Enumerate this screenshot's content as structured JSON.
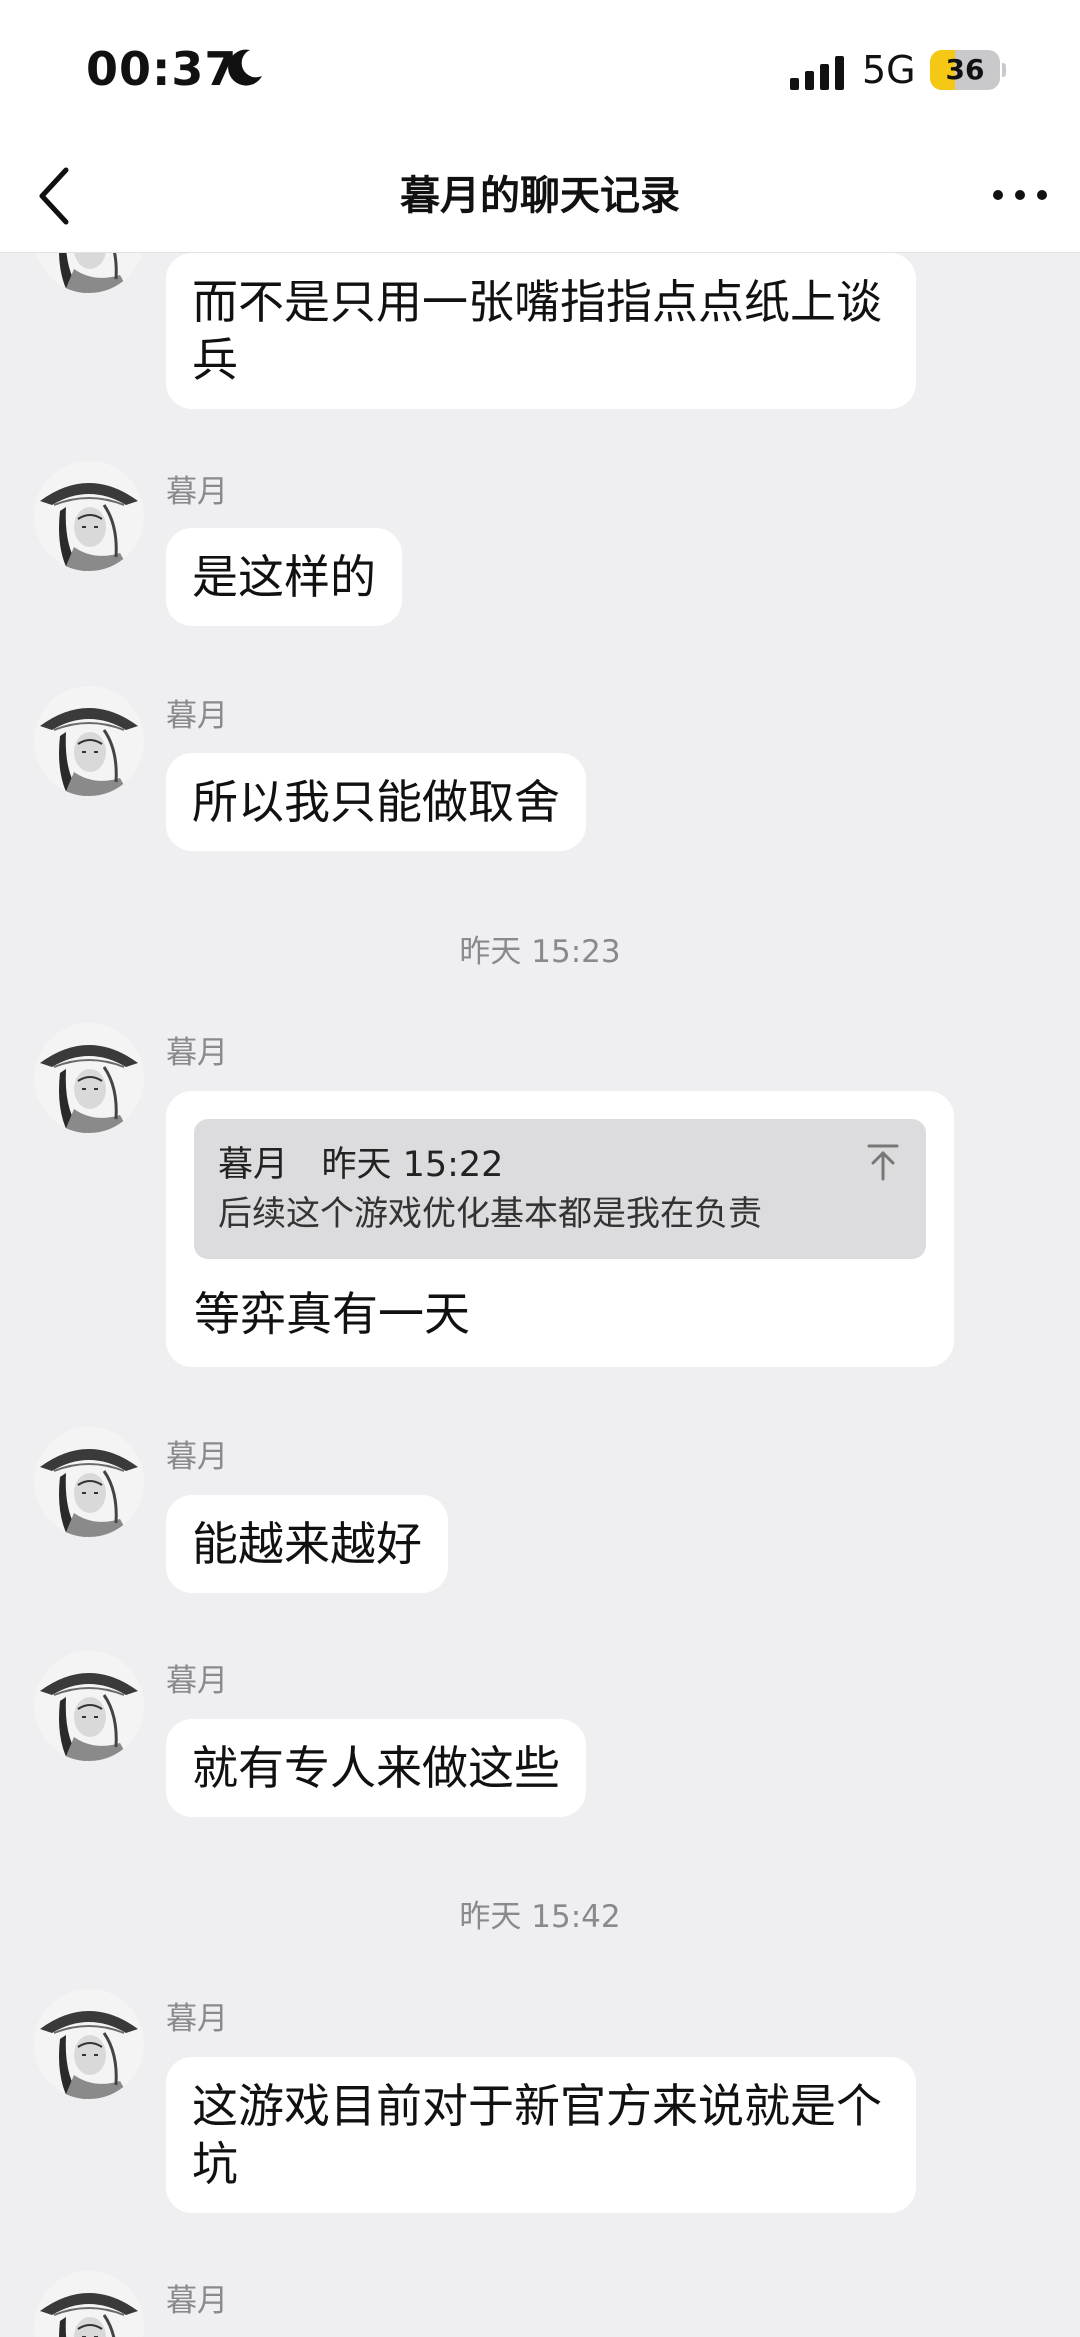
{
  "status_bar": {
    "time": "00:37",
    "network": "5G",
    "battery": "36",
    "battery_level": 0.36
  },
  "header": {
    "title": "暮月的聊天记录"
  },
  "messages": [
    {
      "sender": "",
      "text": "而不是只用一张嘴指指点点纸上谈兵"
    },
    {
      "sender": "暮月",
      "text": "是这样的"
    },
    {
      "sender": "暮月",
      "text": "所以我只能做取舍"
    },
    {
      "timestamp": "昨天 15:23"
    },
    {
      "sender": "暮月",
      "quote": {
        "sender": "暮月",
        "time": "昨天 15:22",
        "text": "后续这个游戏优化基本都是我在负责"
      },
      "text": "等弈真有一天"
    },
    {
      "sender": "暮月",
      "text": "能越来越好"
    },
    {
      "sender": "暮月",
      "text": "就有专人来做这些"
    },
    {
      "timestamp": "昨天 15:42"
    },
    {
      "sender": "暮月",
      "text": "这游戏目前对于新官方来说就是个坑"
    },
    {
      "sender": "暮月",
      "text": ""
    }
  ],
  "colors": {
    "background": "#efeff1",
    "bubble": "#ffffff",
    "battery_accent": "#f4c814",
    "muted_text": "#8a8a8d"
  }
}
